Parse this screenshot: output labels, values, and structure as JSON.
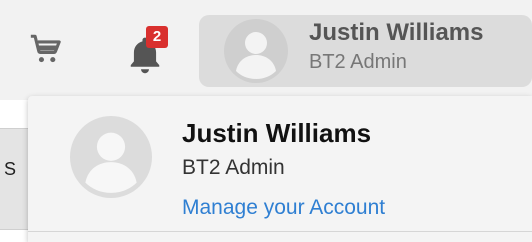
{
  "header": {
    "cart": {
      "icon": "cart-icon"
    },
    "notifications": {
      "icon": "bell-icon",
      "count": "2"
    },
    "user": {
      "name": "Justin Williams",
      "role": "BT2 Admin",
      "avatar_icon": "avatar-placeholder-icon"
    }
  },
  "page": {
    "partial_label": "S"
  },
  "dropdown": {
    "name": "Justin Williams",
    "role": "BT2 Admin",
    "manage_link": "Manage your Account"
  },
  "colors": {
    "badge": "#d9302e",
    "link": "#2f7fd2",
    "user_button_bg": "#dcdcdc"
  }
}
